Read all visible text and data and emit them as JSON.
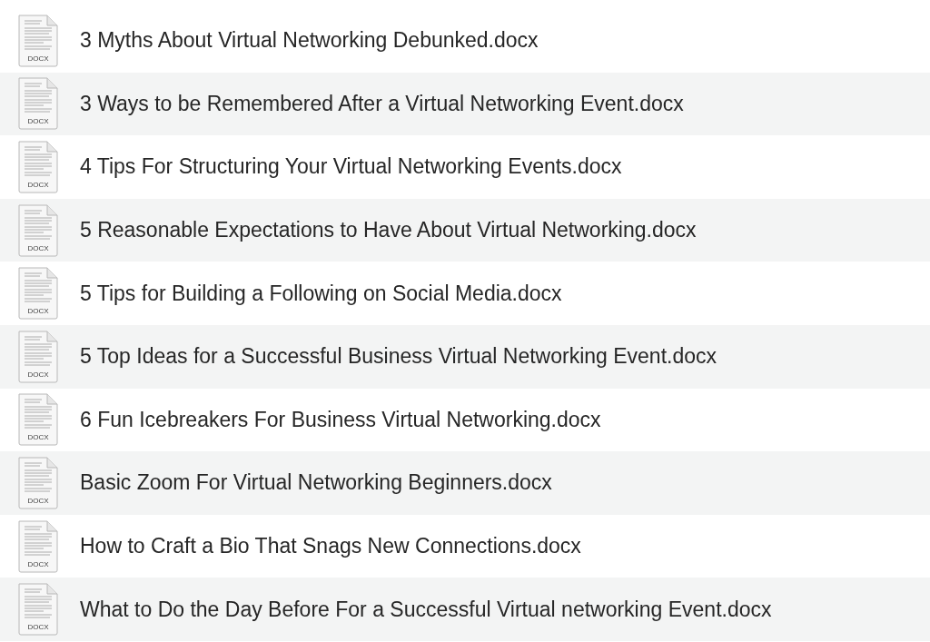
{
  "files": [
    {
      "name": "3 Myths About Virtual Networking Debunked.docx",
      "icon_label": "DOCX"
    },
    {
      "name": "3 Ways to be Remembered After a Virtual Networking Event.docx",
      "icon_label": "DOCX"
    },
    {
      "name": "4 Tips For Structuring Your Virtual Networking Events.docx",
      "icon_label": "DOCX"
    },
    {
      "name": "5 Reasonable Expectations to Have About Virtual Networking.docx",
      "icon_label": "DOCX"
    },
    {
      "name": "5 Tips for Building a Following on Social Media.docx",
      "icon_label": "DOCX"
    },
    {
      "name": "5 Top Ideas for a Successful Business Virtual Networking Event.docx",
      "icon_label": "DOCX"
    },
    {
      "name": "6 Fun Icebreakers For Business Virtual Networking.docx",
      "icon_label": "DOCX"
    },
    {
      "name": "Basic Zoom For Virtual Networking Beginners.docx",
      "icon_label": "DOCX"
    },
    {
      "name": "How to Craft a Bio That Snags New Connections.docx",
      "icon_label": "DOCX"
    },
    {
      "name": "What to Do the Day Before For a Successful Virtual networking Event.docx",
      "icon_label": "DOCX"
    }
  ]
}
